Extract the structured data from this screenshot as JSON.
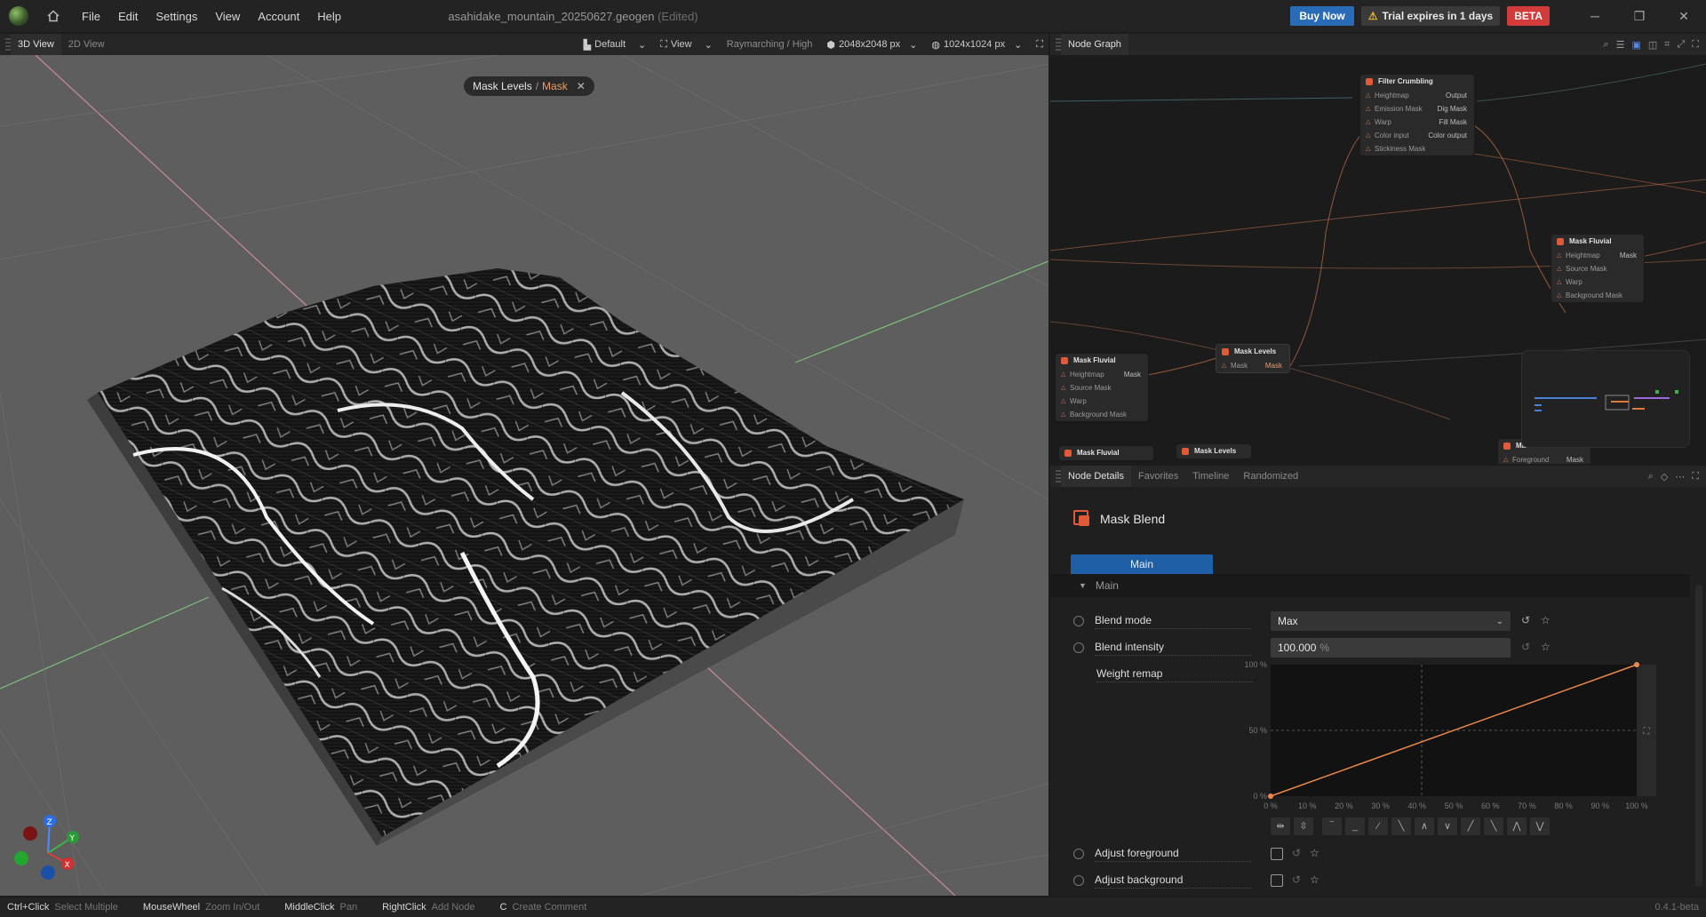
{
  "titlebar": {
    "menu": [
      "File",
      "Edit",
      "Settings",
      "View",
      "Account",
      "Help"
    ],
    "document": "asahidake_mountain_20250627.geogen",
    "edited": "(Edited)",
    "buy_label": "Buy Now",
    "trial_label": "Trial expires in 1 days",
    "beta_label": "BETA"
  },
  "view_panel": {
    "tabs": [
      "3D View",
      "2D View"
    ],
    "preset": "Default",
    "view_label": "View",
    "render_mode": "Raymarching / High",
    "resolution": "2048x2048 px",
    "output_res": "1024x1024 px",
    "breadcrumb_parent": "Mask Levels",
    "breadcrumb_child": "Mask"
  },
  "graph_panel": {
    "title": "Node Graph",
    "nodes": [
      {
        "title": "Filter Crumbling",
        "inputs": [
          "Heightmap",
          "Emission Mask",
          "Warp",
          "Color input",
          "Stickiness Mask"
        ],
        "outputs": [
          "Output",
          "Dig Mask",
          "Fill Mask",
          "Color output"
        ]
      },
      {
        "title": "Mask Fluvial",
        "inputs": [
          "Heightmap",
          "Source Mask",
          "Warp",
          "Background Mask"
        ],
        "outputs": [
          "Mask"
        ]
      },
      {
        "title": "Mask Levels",
        "inputs": [
          "Mask"
        ],
        "outputs": [
          "Mask"
        ]
      },
      {
        "title": "Mask Fluvial",
        "inputs": [
          "Heightmap",
          "Source Mask",
          "Warp",
          "Background Mask"
        ],
        "outputs": [
          "Mask"
        ]
      },
      {
        "title": "Mask Fluvial",
        "inputs": [],
        "outputs": []
      },
      {
        "title": "Mask Levels",
        "inputs": [],
        "outputs": []
      },
      {
        "title": "Ma...",
        "inputs": [
          "Foreground"
        ],
        "outputs": [
          "Mask"
        ]
      }
    ]
  },
  "details_panel": {
    "tabs": [
      "Node Details",
      "Favorites",
      "Timeline",
      "Randomized"
    ],
    "node_name": "Mask Blend",
    "main_tab": "Main",
    "section": "Main",
    "blend_mode_label": "Blend mode",
    "blend_mode_value": "Max",
    "blend_intensity_label": "Blend intensity",
    "blend_intensity_value": "100.000",
    "blend_intensity_unit": "%",
    "weight_remap_label": "Weight remap",
    "curve_y_ticks": [
      "100 %",
      "50 %",
      "0 %"
    ],
    "curve_x_ticks": [
      "0 %",
      "10 %",
      "20 %",
      "30 %",
      "40 %",
      "50 %",
      "60 %",
      "70 %",
      "80 %",
      "90 %",
      "100 %"
    ],
    "curve_points": [
      [
        0,
        0
      ],
      [
        100,
        100
      ]
    ],
    "adjust_fg_label": "Adjust foreground",
    "adjust_bg_label": "Adjust background",
    "accent": "#f08a4b"
  },
  "statusbar": {
    "hints": [
      {
        "key": "Ctrl+Click",
        "action": "Select Multiple"
      },
      {
        "key": "MouseWheel",
        "action": "Zoom In/Out"
      },
      {
        "key": "MiddleClick",
        "action": "Pan"
      },
      {
        "key": "RightClick",
        "action": "Add Node"
      },
      {
        "key": "C",
        "action": "Create Comment"
      }
    ],
    "version": "0.4.1-beta"
  }
}
